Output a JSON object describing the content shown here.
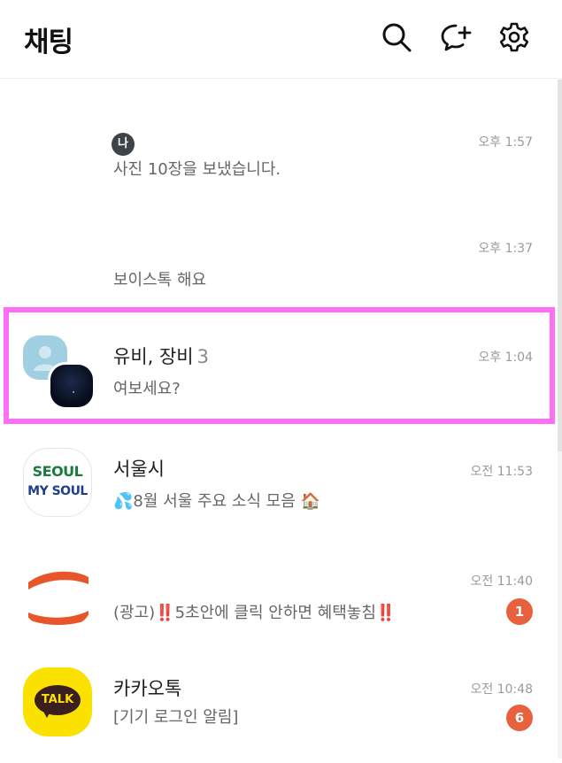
{
  "header": {
    "title": "채팅",
    "icons": [
      "search-icon",
      "new-chat-icon",
      "settings-icon"
    ]
  },
  "chats": [
    {
      "tag": "나",
      "name": "",
      "message": "사진 10장을 보냈습니다.",
      "time": "오후 1:57"
    },
    {
      "name": "",
      "message": "보이스톡 해요",
      "time": "오후 1:37"
    },
    {
      "name": "유비, 장비",
      "member_count": "3",
      "message": "여보세요?",
      "time": "오후 1:04"
    },
    {
      "name": "서울시",
      "message": "💦8월 서울 주요 소식 모음 🏠",
      "time": "오전 11:53",
      "avatar_text": [
        "SEOUL",
        "MY SOUL"
      ]
    },
    {
      "name": "",
      "message": "(광고)‼️5초안에 클릭 안하면 혜택놓침‼️",
      "time": "오전 11:40",
      "unread": "1"
    },
    {
      "name": "카카오톡",
      "message": "[기기 로그인 알림]",
      "time": "오전 10:48",
      "unread": "6",
      "avatar_text": [
        "TALK"
      ]
    }
  ],
  "colors": {
    "highlight": "#ff6ef5",
    "badge": "#e8613e",
    "kakao_yellow": "#fae100"
  }
}
